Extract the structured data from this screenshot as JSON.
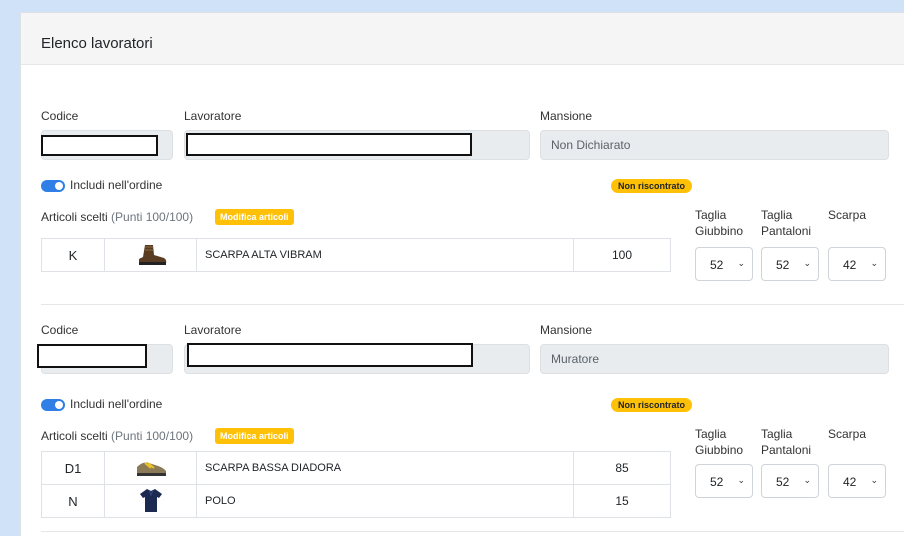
{
  "card": {
    "title": "Elenco lavoratori"
  },
  "labels": {
    "codice": "Codice",
    "lavoratore": "Lavoratore",
    "mansione": "Mansione",
    "includi": "Includi nell'ordine",
    "articoli_scelti": "Articoli scelti",
    "modifica": "Modifica articoli",
    "taglia_giubbino": "Taglia Giubbino",
    "taglia_pantaloni": "Taglia Pantaloni",
    "scarpa": "Scarpa"
  },
  "workers": [
    {
      "mansione": "Non Dichiarato",
      "status": "Non riscontrato",
      "punti": "(Punti 100/100)",
      "items": [
        {
          "code": "K",
          "icon": "high-boot-icon",
          "name": "SCARPA ALTA VIBRAM",
          "points": "100"
        }
      ],
      "giubbino": "52",
      "pantaloni": "52",
      "scarpa": "42"
    },
    {
      "mansione": "Muratore",
      "status": "Non riscontrato",
      "punti": "(Punti 100/100)",
      "items": [
        {
          "code": "D1",
          "icon": "low-shoe-icon",
          "name": "SCARPA BASSA DIADORA",
          "points": "85"
        },
        {
          "code": "N",
          "icon": "polo-shirt-icon",
          "name": "POLO",
          "points": "15"
        }
      ],
      "giubbino": "52",
      "pantaloni": "52",
      "scarpa": "42"
    }
  ],
  "colors": {
    "accent": "#2f7fe6",
    "badge": "#ffc107",
    "background": "#cfe2f7"
  }
}
